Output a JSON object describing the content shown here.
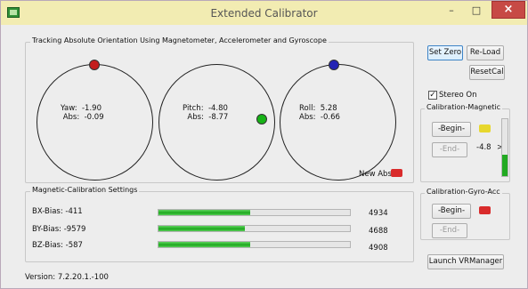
{
  "window": {
    "title": "Extended Calibrator",
    "minimize_label": "–",
    "maximize_label": "□",
    "close_label": "×"
  },
  "tracking": {
    "title": "Tracking Absolute Orientation Using Magnetometer, Accelerometer and Gyroscope",
    "yaw": "Yaw:  -1.90\n Abs:  -0.09",
    "pitch": "Pitch:  -4.80\n  Abs:  -8.77",
    "roll": "Roll:  5.28\nAbs:  -0.66",
    "new_abs_label": "New Abs:",
    "new_abs_color": "#d92b2b",
    "yaw_dot_color": "#c41d1d",
    "pitch_dot_color": "#17b317",
    "roll_dot_color": "#2323b4"
  },
  "magnetic_settings": {
    "title": "Magnetic-Calibration Settings",
    "rows": [
      {
        "label": "BX-Bias:  -411",
        "fill": 0.48,
        "value": "4934"
      },
      {
        "label": "BY-Bias:  -9579",
        "fill": 0.45,
        "value": "4688"
      },
      {
        "label": "BZ-Bias:  -587",
        "fill": 0.48,
        "value": "4908"
      }
    ]
  },
  "version": "Version: 7.2.20.1.-100",
  "side": {
    "set_zero": "Set Zero",
    "reload": "Re-Load",
    "reset_cal": "ResetCal",
    "stereo_on": "Stereo On",
    "stereo_checked": "✓",
    "mag_title": "Calibration-Magnetic",
    "mag_begin": "-Begin-",
    "mag_end": "-End-",
    "mag_value": "-4.8",
    "mag_arrow": ">",
    "mag_led_color": "#e7d72e",
    "mag_level": 0.38,
    "gyro_title": "Calibration-Gyro-Acc",
    "gyro_begin": "-Begin-",
    "gyro_end": "-End-",
    "gyro_led_color": "#d92b2b",
    "launch": "Launch VRManager"
  }
}
